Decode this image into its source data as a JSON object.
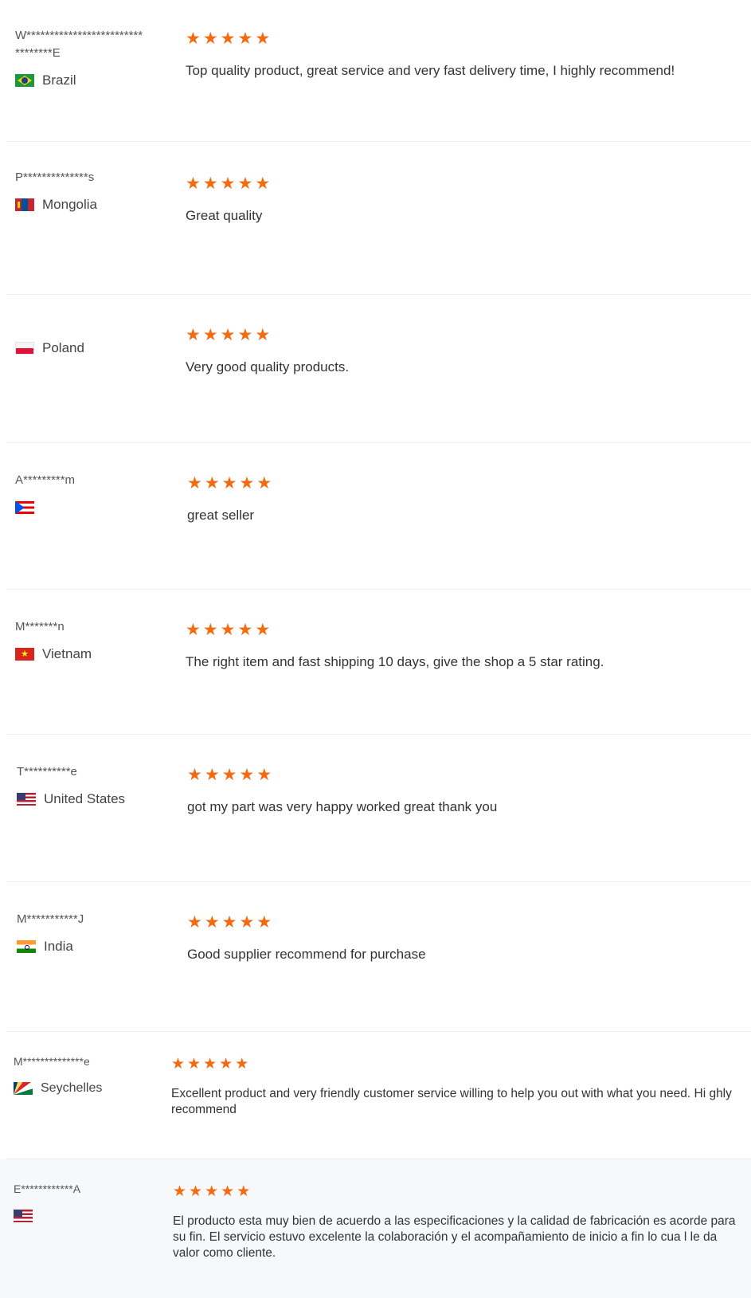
{
  "star_glyph": "★",
  "star_color": "#f46a10",
  "reviews": [
    {
      "name": "W*************************\n********E",
      "country": "Brazil",
      "flag": "brazil-flag-icon",
      "rating": 5,
      "comment": "Top quality product, great service and very fast delivery time, I highly recommend!"
    },
    {
      "name": "P**************s",
      "country": "Mongolia",
      "flag": "mongolia-flag-icon",
      "rating": 5,
      "comment": "Great quality"
    },
    {
      "name": "",
      "country": "Poland",
      "flag": "poland-flag-icon",
      "rating": 5,
      "comment": "Very good quality products."
    },
    {
      "name": "A*********m",
      "country": "",
      "flag": "puerto-rico-flag-icon",
      "rating": 5,
      "comment": "great seller"
    },
    {
      "name": "M*******n",
      "country": "Vietnam",
      "flag": "vietnam-flag-icon",
      "rating": 5,
      "comment": "The right item and fast shipping 10 days, give the shop a 5 star rating."
    },
    {
      "name": "T**********e",
      "country": "United States",
      "flag": "us-flag-icon",
      "rating": 5,
      "comment": "got my part was very happy worked great thank you"
    },
    {
      "name": "M***********J",
      "country": "India",
      "flag": "india-flag-icon",
      "rating": 5,
      "comment": "Good supplier recommend for purchase"
    },
    {
      "name": "M**************e",
      "country": "Seychelles",
      "flag": "seychelles-flag-icon",
      "rating": 5,
      "comment": "Excellent product and very friendly customer service willing to help you out with what you need. Hi ghly recommend"
    },
    {
      "name": "E************A",
      "country": "",
      "flag": "us-flag-icon",
      "rating": 5,
      "comment": "El producto esta muy bien de acuerdo a las especificaciones y la calidad de fabricación es acorde para su fin. El servicio estuvo excelente la colaboración y el acompañamiento de inicio a fin lo cua l le da valor como cliente."
    }
  ]
}
